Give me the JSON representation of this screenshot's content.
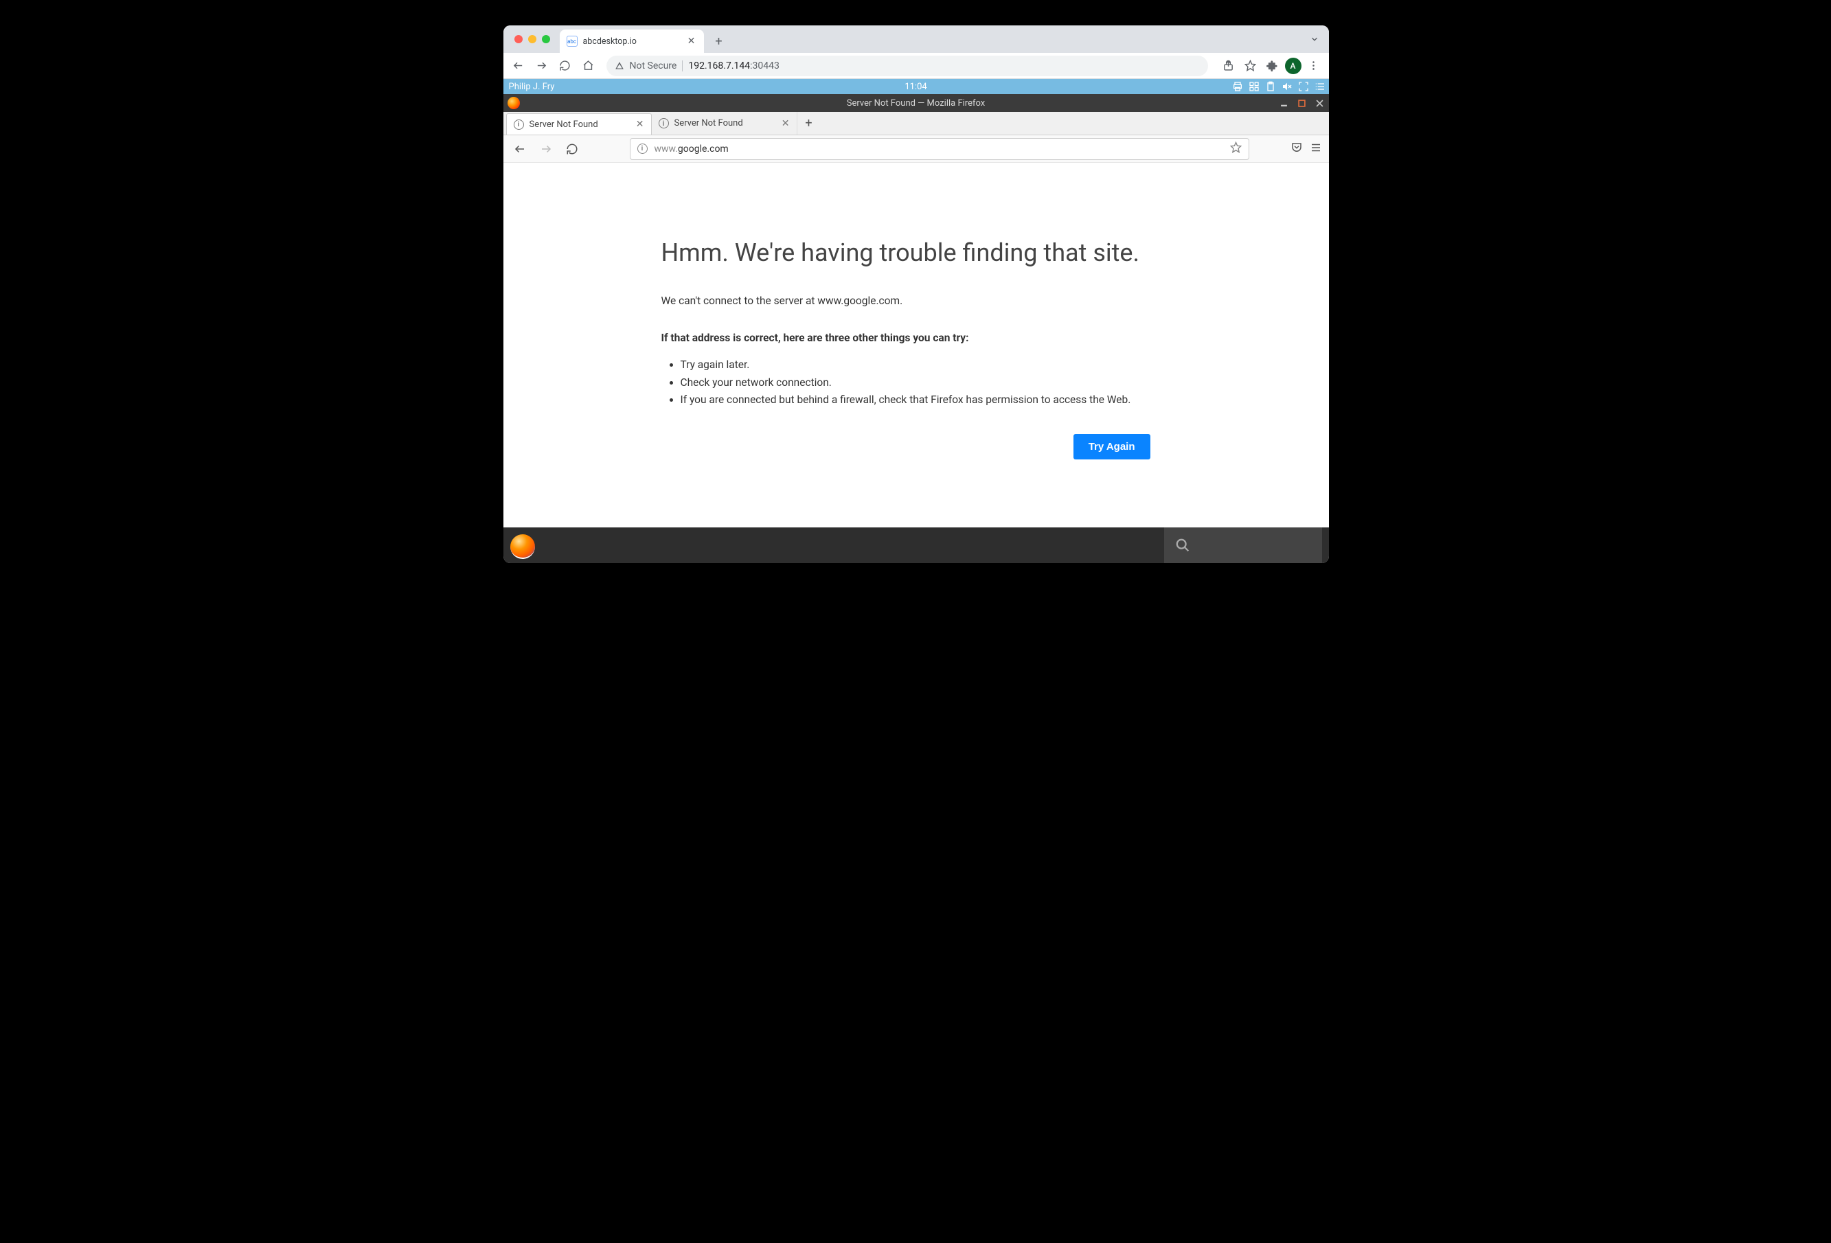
{
  "outer_chrome": {
    "tab_title": "abcdesktop.io",
    "favicon_text": "abc",
    "not_secure_label": "Not Secure",
    "address_host": "192.168.7.144",
    "address_port": ":30443",
    "avatar_letter": "A"
  },
  "abc_bar": {
    "username": "Philip J. Fry",
    "clock": "11:04"
  },
  "inner_firefox": {
    "window_title": "Server Not Found — Mozilla Firefox",
    "tabs": [
      {
        "title": "Server Not Found"
      },
      {
        "title": "Server Not Found"
      }
    ],
    "url_prefix": "www.",
    "url_host": "google.com"
  },
  "error_page": {
    "heading": "Hmm. We're having trouble finding that site.",
    "cant_connect": "We can't connect to the server at www.google.com.",
    "if_correct": "If that address is correct, here are three other things you can try:",
    "tips": [
      "Try again later.",
      "Check your network connection.",
      "If you are connected but behind a firewall, check that Firefox has permission to access the Web."
    ],
    "try_again": "Try Again"
  }
}
